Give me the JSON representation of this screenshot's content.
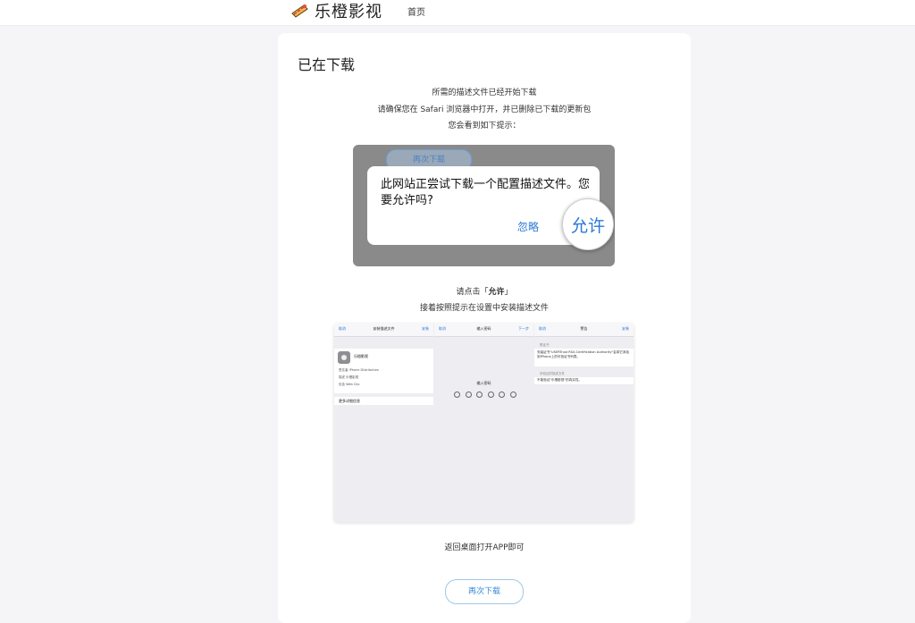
{
  "header": {
    "brand_name": "乐橙影视",
    "nav_home": "首页"
  },
  "card": {
    "title": "已在下载",
    "intro_lines": [
      "所需的描述文件已经开始下载",
      "请确保您在 Safari 浏览器中打开，并已删除已下载的更新包",
      "您会看到如下提示："
    ],
    "prompt_mockup": {
      "ghost_button": "再次下载",
      "message": "此网站正尝试下载一个配置描述文件。您要允许吗?",
      "ignore": "忽略",
      "allow": "允许"
    },
    "instruction": {
      "prefix": "请点击「",
      "allow": "允许",
      "suffix": "」",
      "line2": "接着按照提示在设置中安装描述文件"
    },
    "settings_mockup": {
      "pane1": {
        "left": "取消",
        "title": "安装描述文件",
        "right": "安装",
        "profile_name": "乐橙影视",
        "rows": [
          "签名者  iPhone Distribution",
          "描述  乐橙影视",
          "包含  Web Clip"
        ],
        "more": "更多详细信息"
      },
      "pane2": {
        "left": "取消",
        "title": "输入密码",
        "right": "下一步",
        "label": "输入密码"
      },
      "pane3": {
        "left": "取消",
        "title": "警告",
        "right": "安装",
        "head1": "根证书",
        "text1": "安装证书\"USERTrust RSA Certification Authority\"会将它添加到iPhone上的可信证书列表。",
        "head2": "未验证的描述文件",
        "text2": "不能验证\"乐橙影视\"的真实性。"
      }
    },
    "footer_note": "返回桌面打开APP即可",
    "redownload_button": "再次下载"
  }
}
